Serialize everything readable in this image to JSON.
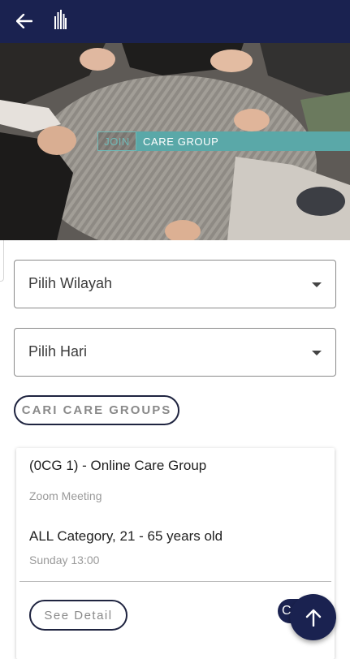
{
  "header": {
    "back_icon": "arrow-left-icon",
    "logo_icon": "church-building-logo"
  },
  "hero": {
    "join_text": "JOIN",
    "banner_text": "CARE GROUP"
  },
  "filters": {
    "region_label": "Pilih Wilayah",
    "day_label": "Pilih Hari",
    "search_button": "CARI CARE GROUPS"
  },
  "groups": [
    {
      "title": "(0CG 1) - Online Care Group",
      "venue": "Zoom Meeting",
      "category": "ALL Category, 21 - 65 years old",
      "schedule": "Sunday 13:00",
      "detail_button": "See Detail",
      "secondary_button_initial": "C"
    }
  ],
  "fab_icon": "arrow-up-icon",
  "colors": {
    "appbar": "#1a2250",
    "banner_teal": "#5aa8a8",
    "button_border": "#1f2440"
  }
}
